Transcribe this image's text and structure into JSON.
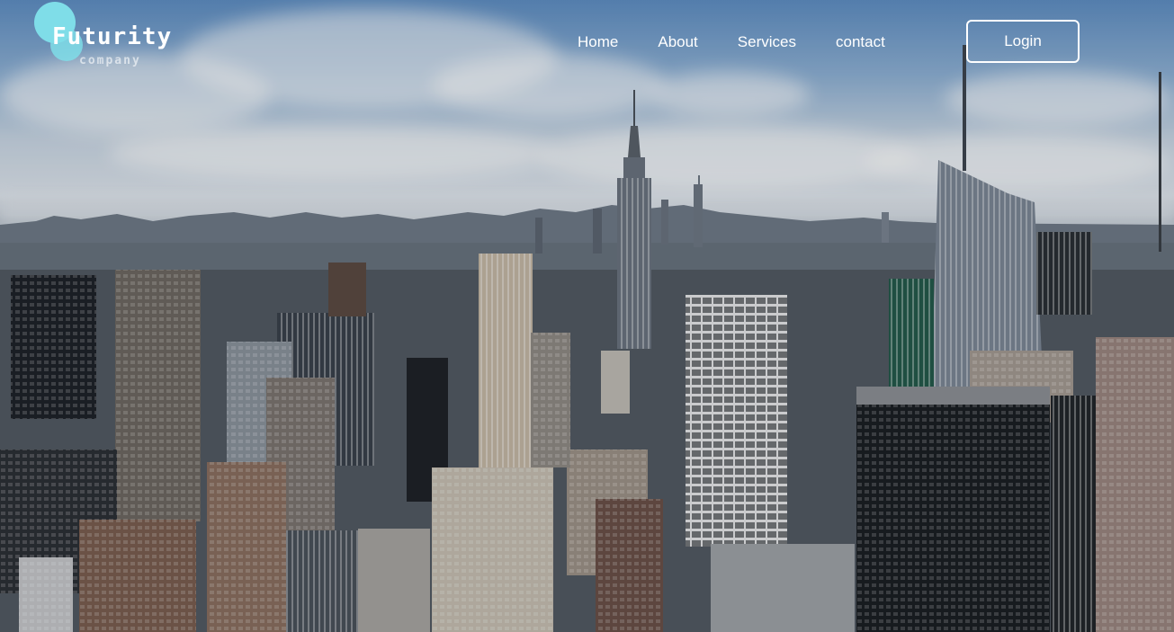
{
  "logo": {
    "title": "Futurity",
    "subtitle": "company"
  },
  "nav": {
    "items": [
      {
        "label": "Home"
      },
      {
        "label": "About"
      },
      {
        "label": "Services"
      },
      {
        "label": "contact"
      }
    ],
    "login_label": "Login"
  },
  "colors": {
    "logo_accent": "#7fdde8",
    "nav_text": "#ffffff"
  }
}
